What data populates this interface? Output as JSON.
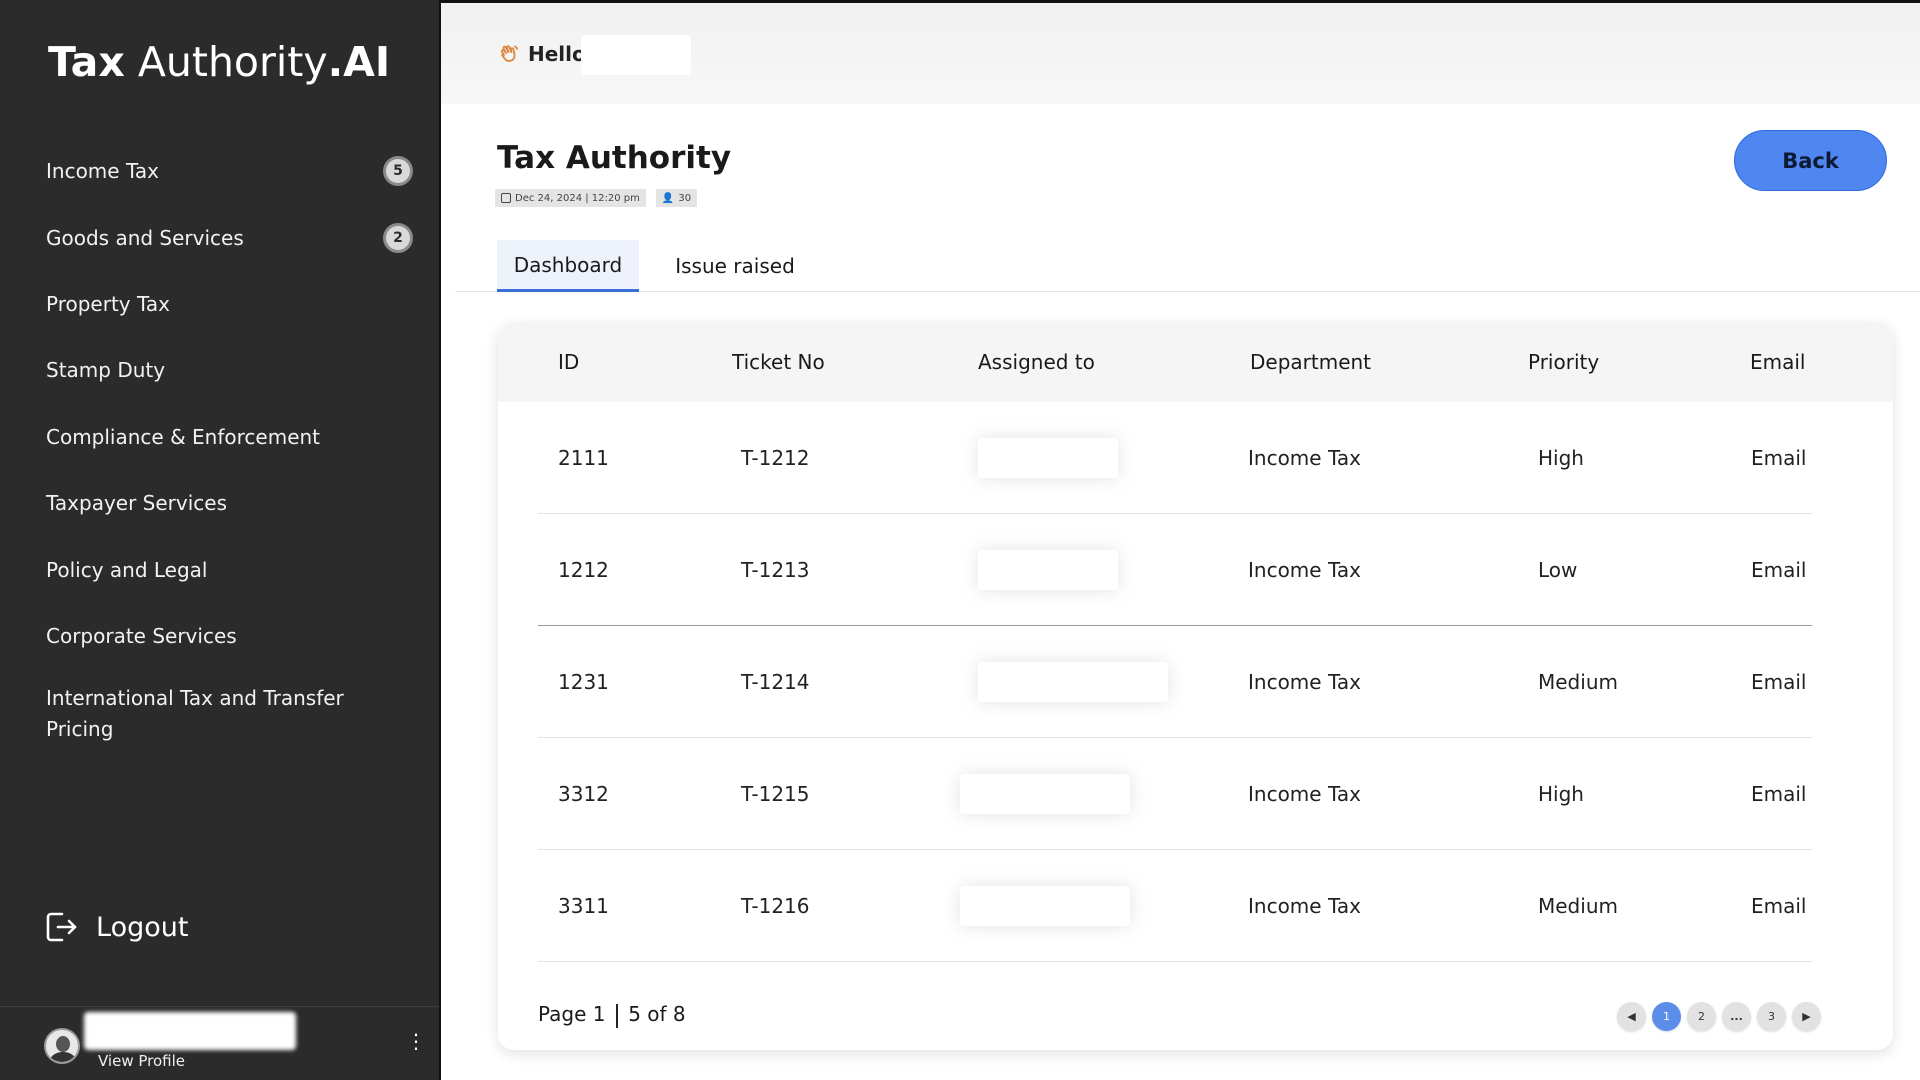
{
  "brand": {
    "part1": "Tax",
    "part2": " Authority",
    "part3": ".AI"
  },
  "sidebar": {
    "items": [
      {
        "label": "Income Tax",
        "badge": "5"
      },
      {
        "label": "Goods and Services",
        "badge": "2"
      },
      {
        "label": "Property Tax"
      },
      {
        "label": "Stamp Duty"
      },
      {
        "label": "Compliance & Enforcement"
      },
      {
        "label": "Taxpayer Services"
      },
      {
        "label": "Policy and Legal"
      },
      {
        "label": "Corporate Services"
      },
      {
        "label": "International Tax and Transfer Pricing"
      }
    ],
    "logout_label": "Logout",
    "view_profile_label": "View Profile"
  },
  "header": {
    "greeting": "Hello"
  },
  "page": {
    "title": "Tax Authority",
    "date_chip": "Dec 24, 2024 | 12:20 pm",
    "user_chip": "30",
    "back_label": "Back"
  },
  "tabs": [
    {
      "label": "Dashboard",
      "active": true
    },
    {
      "label": "Issue raised",
      "active": false
    }
  ],
  "table": {
    "columns": [
      "ID",
      "Ticket No",
      "Assigned to",
      "Department",
      "Priority",
      "Email"
    ],
    "rows": [
      {
        "id": "2111",
        "ticket": "T-1212",
        "department": "Income Tax",
        "priority": "High",
        "email": "Email"
      },
      {
        "id": "1212",
        "ticket": "T-1213",
        "department": "Income Tax",
        "priority": "Low",
        "email": "Email"
      },
      {
        "id": "1231",
        "ticket": "T-1214",
        "department": "Income Tax",
        "priority": "Medium",
        "email": "Email"
      },
      {
        "id": "3312",
        "ticket": "T-1215",
        "department": "Income Tax",
        "priority": "High",
        "email": "Email"
      },
      {
        "id": "3311",
        "ticket": "T-1216",
        "department": "Income Tax",
        "priority": "Medium",
        "email": "Email"
      }
    ]
  },
  "pagination": {
    "page_text": "Page 1",
    "count_text": "5 of 8",
    "pages": [
      "1",
      "2",
      "...",
      "3"
    ],
    "current": "1"
  },
  "colors": {
    "sidebar_bg": "#2b2b2b",
    "accent": "#4f86f0",
    "active_tab_underline": "#3b6fd8"
  },
  "icons": {
    "hello": "waving-hand-icon",
    "logout": "logout-icon",
    "prev": "chevron-left-icon",
    "next": "chevron-right-icon",
    "date": "calendar-icon",
    "user": "user-icon",
    "more": "kebab-menu-icon"
  }
}
